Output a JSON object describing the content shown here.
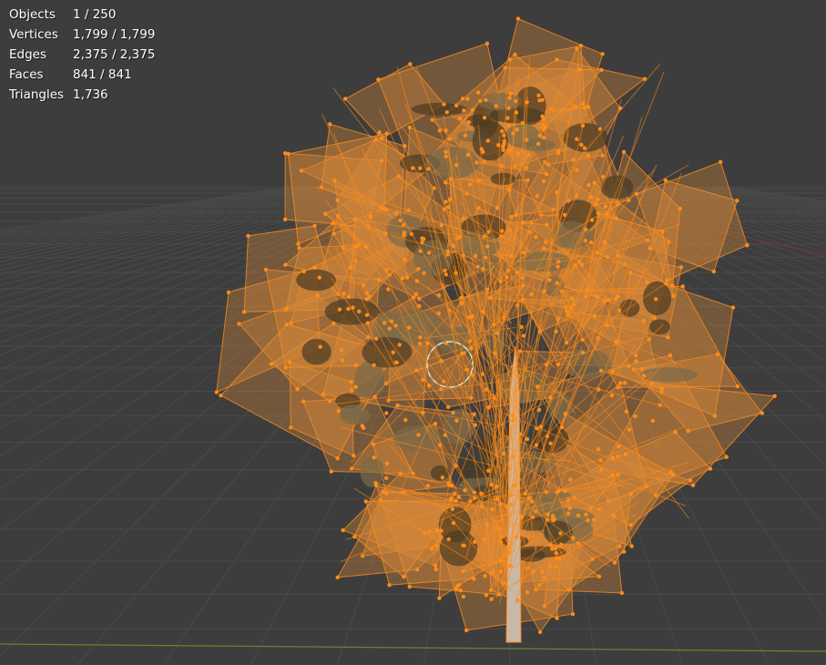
{
  "stats": [
    {
      "label": "Objects",
      "value": "1 / 250"
    },
    {
      "label": "Vertices",
      "value": "1,799 / 1,799"
    },
    {
      "label": "Edges",
      "value": "2,375 / 2,375"
    },
    {
      "label": "Faces",
      "value": "841 / 841"
    },
    {
      "label": "Triangles",
      "value": "1,736"
    }
  ],
  "colors": {
    "background": "#3d3d3d",
    "grid": "#4a4a4a",
    "axis_x": "#8b3a3a",
    "axis_y": "#6b8e23",
    "selection": "#ff8c1a",
    "selection_fill": "#d98a3a",
    "foliage_dark": "#4a3a22",
    "foliage_mid": "#7a6a48",
    "trunk": "#c8b8a8",
    "cursor": "#f0f0c8"
  },
  "icons": {
    "cursor": "3d-cursor-icon"
  }
}
